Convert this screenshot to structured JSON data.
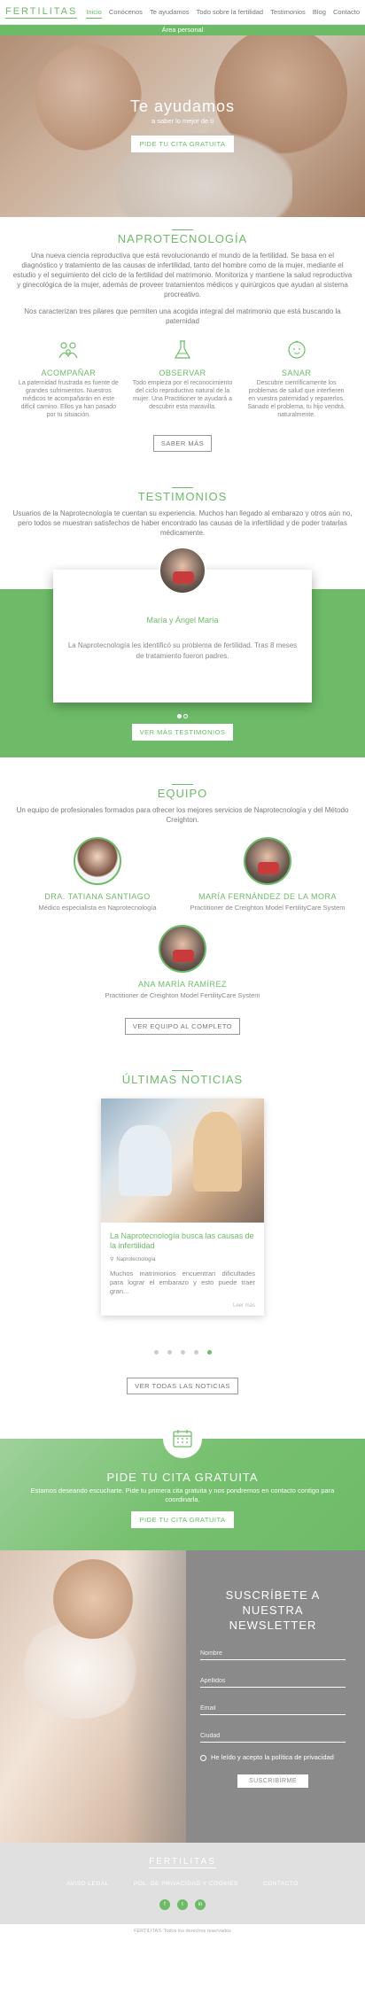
{
  "header": {
    "logo": "FERTILITAS",
    "nav": [
      "Inicio",
      "Conócenos",
      "Te ayudamos",
      "Todo sobre la fertilidad",
      "Testimonios",
      "Blog",
      "Contacto"
    ],
    "area": "Área personal"
  },
  "hero": {
    "title": "Te ayudamos",
    "subtitle": "a saber lo mejor de ti",
    "button": "PIDE TU CITA GRATUITA"
  },
  "napro": {
    "title": "NAPROTECNOLOGÍA",
    "p1": "Una nueva ciencia reproductiva que está revolucionando el mundo de la fertilidad. Se basa en el diagnóstico y tratamiento de las causas de infertilidad, tanto del hombre como de la mujer, mediante el estudio y el seguimiento del ciclo de la fertilidad del matrimonio. Monitoriza y mantiene la salud reproductiva y ginecológica de la mujer, además de proveer tratamientos médicos y quirúrgicos que ayudan al sistema procreativo.",
    "p2": "Nos caracterizan tres pilares que permiten una acogida integral del matrimonio que está buscando la paternidad",
    "pillars": [
      {
        "title": "ACOMPAÑAR",
        "text": "La paternidad frustrada es fuente de grandes sufrimientos. Nuestros médicos te acompañarán en este difícil camino. Ellos ya han pasado por tu situación."
      },
      {
        "title": "OBSERVAR",
        "text": "Todo empieza por el reconocimiento del ciclo reproductivo natural de la mujer. Una Practitioner te ayudará a descubrir esta maravilla."
      },
      {
        "title": "SANAR",
        "text": "Descubre científicamente los problemas de salud que interfieren en vuestra paternidad y reparerlos. Sanado el problema, tu hijo vendrá, naturalmente."
      }
    ],
    "button": "SABER MÁS"
  },
  "testimonials": {
    "title": "TESTIMONIOS",
    "intro": "Usuarios de la Naprotecnología te cuentan su experiencia. Muchos han llegado al embarazo y otros aún no, pero todos se muestran satisfechos de haber encontrado las causas de la infertilidad y de poder tratarlas médicamente.",
    "name": "María y Ángel María",
    "quote": "La Naprotecnología les identificó su problema de fertilidad. Tras 8 meses de tratamiento fueron padres.",
    "button": "VER MÁS TESTIMONIOS"
  },
  "team": {
    "title": "EQUIPO",
    "intro": "Un equipo de profesionales formados para ofrecer los mejores servicios de Naprotecnología y del Método Creighton.",
    "members": [
      {
        "name": "DRA. TATIANA SANTIAGO",
        "role": "Médico especialista en Naprotecnología"
      },
      {
        "name": "MARÍA FERNÁNDEZ DE LA MORA",
        "role": "Practitioner de Creighton Model FertilityCare System"
      },
      {
        "name": "ANA MARÍA RAMÍREZ",
        "role": "Practitioner de Creighton Model FertilityCare System"
      }
    ],
    "button": "VER EQUIPO AL COMPLETO"
  },
  "news": {
    "title": "ÚLTIMAS NOTICIAS",
    "card_title": "La Naprotecnología busca las causas de la infertilidad",
    "tag": "Naprotecnología",
    "excerpt": "Muchos matrimonios encuentran dificultades para lograr el embarazo y esto puede traer gran...",
    "read_more": "Leer más",
    "button": "VER TODAS LAS NOTICIAS"
  },
  "cta": {
    "title": "PIDE TU CITA GRATUITA",
    "text": "Estamos deseando escucharte. Pide tu primera cita gratuita y nos pondremos en contacto contigo para coordinarla.",
    "button": "PIDE TU CITA GRATUITA"
  },
  "newsletter": {
    "title": "SUSCRÍBETE A NUESTRA NEWSLETTER",
    "fields": [
      "Nombre",
      "Apellidos",
      "Email",
      "Ciudad"
    ],
    "consent_lead": "He leído y acepto",
    "consent_link": "la política de privacidad",
    "button": "SUSCRIBIRME"
  },
  "footer": {
    "logo": "FERTILITAS",
    "links": [
      "AVISO LEGAL",
      "POL. DE PRIVACIDAD Y COOKIES",
      "CONTACTO"
    ],
    "social": [
      "f",
      "t",
      "in"
    ],
    "copyright": "FERTILITAS. Todos los derechos reservados"
  },
  "colors": {
    "accent": "#6dbb68",
    "grey": "#8a8a8a"
  }
}
